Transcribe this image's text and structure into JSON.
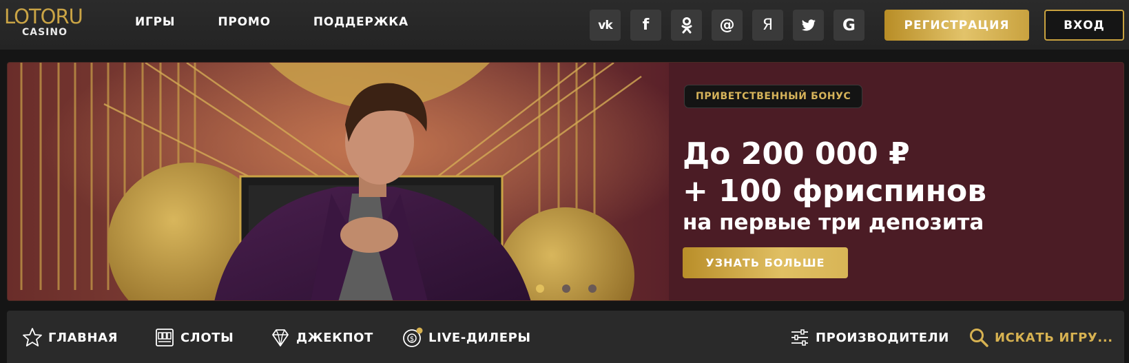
{
  "logo": {
    "main": "LOTORU",
    "sub": "CASINO"
  },
  "nav": [
    {
      "label": "ИГРЫ"
    },
    {
      "label": "ПРОМО"
    },
    {
      "label": "ПОДДЕРЖКА"
    }
  ],
  "socials": [
    {
      "label": "VK",
      "icon": "vk-icon"
    },
    {
      "label": "f",
      "icon": "facebook-icon"
    },
    {
      "label": "OK",
      "icon": "odnoklassniki-icon"
    },
    {
      "label": "@",
      "icon": "mail-icon"
    },
    {
      "label": "Я",
      "icon": "yandex-icon"
    },
    {
      "label": "",
      "icon": "twitter-icon"
    },
    {
      "label": "G",
      "icon": "google-icon"
    }
  ],
  "header_buttons": {
    "register": "РЕГИСТРАЦИЯ",
    "login": "ВХОД"
  },
  "banner": {
    "badge": "ПРИВЕТСТВЕННЫЙ БОНУС",
    "headline1": "До 200 000 ₽",
    "headline2": "+ 100 фриспинов",
    "subline": "на первые три депозита",
    "button": "УЗНАТЬ БОЛЬШЕ",
    "slides": 3,
    "active_slide": 1
  },
  "bottom_nav": [
    {
      "label": "ГЛАВНАЯ",
      "icon": "star-icon"
    },
    {
      "label": "СЛОТЫ",
      "icon": "slot-machine-icon"
    },
    {
      "label": "ДЖЕКПОТ",
      "icon": "diamond-icon"
    },
    {
      "label": "LIVE-ДИЛЕРЫ",
      "icon": "live-chip-icon"
    },
    {
      "label": "ПРОИЗВОДИТЕЛИ",
      "icon": "sliders-icon"
    }
  ],
  "search": {
    "placeholder": "ИСКАТЬ ИГРУ..."
  },
  "colors": {
    "gold": "#caa445",
    "banner_bg": "#4b1c25",
    "header_bg": "#262626",
    "bar_bg": "#2a2a2a"
  }
}
